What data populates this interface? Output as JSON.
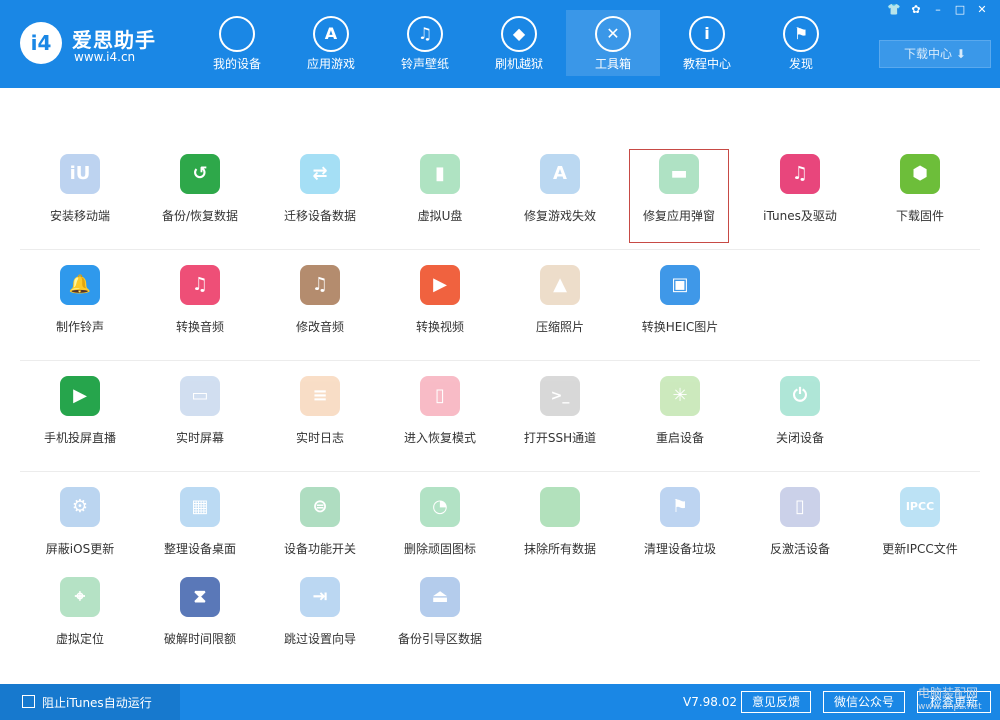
{
  "app": {
    "title": "爱思助手",
    "url": "www.i4.cn",
    "logo_text": "i4"
  },
  "nav": [
    {
      "label": "我的设备",
      "icon": "apple-icon",
      "glyph": ""
    },
    {
      "label": "应用游戏",
      "icon": "app-store-icon",
      "glyph": "A"
    },
    {
      "label": "铃声壁纸",
      "icon": "music-folder-icon",
      "glyph": "♫"
    },
    {
      "label": "刷机越狱",
      "icon": "dropbox-icon",
      "glyph": "◆"
    },
    {
      "label": "工具箱",
      "icon": "tools-icon",
      "glyph": "✕",
      "active": true
    },
    {
      "label": "教程中心",
      "icon": "info-icon",
      "glyph": "i"
    },
    {
      "label": "发现",
      "icon": "flag-icon",
      "glyph": "⚑"
    }
  ],
  "window_controls": [
    {
      "name": "skin-icon",
      "glyph": "👕"
    },
    {
      "name": "settings-icon",
      "glyph": "✿"
    },
    {
      "name": "minimize-icon",
      "glyph": "–"
    },
    {
      "name": "maximize-icon",
      "glyph": "□"
    },
    {
      "name": "close-icon",
      "glyph": "✕"
    }
  ],
  "download_center": {
    "label": "下载中心",
    "icon": "download-icon",
    "glyph": "⬇"
  },
  "tools": [
    [
      {
        "label": "安装移动端",
        "icon": "i4-mobile-icon",
        "color": "#6f9fe0",
        "glyph": "iU",
        "faded": true
      },
      {
        "label": "备份/恢复数据",
        "icon": "backup-restore-icon",
        "color": "#2ea84a",
        "glyph": "↺"
      },
      {
        "label": "迁移设备数据",
        "icon": "migrate-data-icon",
        "color": "#3ab9ea",
        "glyph": "⇄",
        "faded": true
      },
      {
        "label": "虚拟U盘",
        "icon": "usb-drive-icon",
        "color": "#4fc27a",
        "glyph": "▮",
        "faded": true
      },
      {
        "label": "修复游戏失效",
        "icon": "fix-game-icon",
        "color": "#6aa9e2",
        "glyph": "A",
        "faded": true
      },
      {
        "label": "修复应用弹窗",
        "icon": "apple-id-card-icon",
        "color": "#50c07e",
        "glyph": "▬",
        "faded": true,
        "selected": true
      },
      {
        "label": "iTunes及驱动",
        "icon": "itunes-icon",
        "color": "#e8467c",
        "glyph": "♫"
      },
      {
        "label": "下载固件",
        "icon": "firmware-cube-icon",
        "color": "#6dbe3a",
        "glyph": "⬢"
      }
    ],
    [
      {
        "label": "制作铃声",
        "icon": "bell-icon",
        "color": "#2f99ec",
        "glyph": "🔔"
      },
      {
        "label": "转换音频",
        "icon": "convert-audio-icon",
        "color": "#ee4f77",
        "glyph": "♫"
      },
      {
        "label": "修改音频",
        "icon": "edit-audio-icon",
        "color": "#b48c6e",
        "glyph": "♫"
      },
      {
        "label": "转换视频",
        "icon": "convert-video-icon",
        "color": "#f0623f",
        "glyph": "▶"
      },
      {
        "label": "压缩照片",
        "icon": "compress-photo-icon",
        "color": "#d9b48c",
        "glyph": "▲",
        "faded": true
      },
      {
        "label": "转换HEIC图片",
        "icon": "heic-icon",
        "color": "#3f98e8",
        "glyph": "▣"
      }
    ],
    [
      {
        "label": "手机投屏直播",
        "icon": "screen-mirror-icon",
        "color": "#26a54c",
        "glyph": "▶"
      },
      {
        "label": "实时屏幕",
        "icon": "monitor-icon",
        "color": "#9ab8df",
        "glyph": "▭",
        "faded": true
      },
      {
        "label": "实时日志",
        "icon": "log-icon",
        "color": "#f1b582",
        "glyph": "≡",
        "faded": true
      },
      {
        "label": "进入恢复模式",
        "icon": "recovery-mode-icon",
        "color": "#f06a82",
        "glyph": "▯",
        "faded": true
      },
      {
        "label": "打开SSH通道",
        "icon": "ssh-terminal-icon",
        "color": "#aaaaaa",
        "glyph": ">_",
        "faded": true
      },
      {
        "label": "重启设备",
        "icon": "restart-icon",
        "color": "#8fd06e",
        "glyph": "✳",
        "faded": true
      },
      {
        "label": "关闭设备",
        "icon": "power-icon",
        "color": "#4fcaa8",
        "glyph": "⏻",
        "faded": true
      }
    ],
    [
      {
        "label": "屏蔽iOS更新",
        "icon": "block-update-icon",
        "color": "#6aa3df",
        "glyph": "⚙",
        "faded": true
      },
      {
        "label": "整理设备桌面",
        "icon": "organize-desktop-icon",
        "color": "#6aaee6",
        "glyph": "▦",
        "faded": true
      },
      {
        "label": "设备功能开关",
        "icon": "feature-toggle-icon",
        "color": "#4fb678",
        "glyph": "⊜",
        "faded": true
      },
      {
        "label": "删除顽固图标",
        "icon": "delete-icon-icon",
        "color": "#57c07f",
        "glyph": "◔",
        "faded": true
      },
      {
        "label": "抹除所有数据",
        "icon": "erase-data-icon",
        "color": "#55bd6b",
        "glyph": "",
        "faded": true
      },
      {
        "label": "清理设备垃圾",
        "icon": "clean-junk-icon",
        "color": "#6ea2e2",
        "glyph": "⚑",
        "faded": true
      },
      {
        "label": "反激活设备",
        "icon": "deactivate-icon",
        "color": "#8e9bd0",
        "glyph": "▯",
        "faded": true
      },
      {
        "label": "更新IPCC文件",
        "icon": "ipcc-icon",
        "color": "#6cc0ea",
        "glyph": "IPCC",
        "faded": true
      }
    ],
    [
      {
        "label": "虚拟定位",
        "icon": "location-pin-icon",
        "color": "#5cc07f",
        "glyph": "⌖",
        "faded": true
      },
      {
        "label": "破解时间限额",
        "icon": "hourglass-icon",
        "color": "#5a78b8",
        "glyph": "⧗"
      },
      {
        "label": "跳过设置向导",
        "icon": "skip-wizard-icon",
        "color": "#6aa7e4",
        "glyph": "⇥",
        "faded": true
      },
      {
        "label": "备份引导区数据",
        "icon": "boot-backup-icon",
        "color": "#5a8fd6",
        "glyph": "⏏",
        "faded": true
      }
    ]
  ],
  "footer": {
    "checkbox_label": "阻止iTunes自动运行",
    "version": "V7.98.02",
    "feedback": "意见反馈",
    "wechat": "微信公众号",
    "update": "检查更新",
    "watermark_line1": "电脑装配网",
    "watermark_line2": "www.dnpz.net"
  }
}
